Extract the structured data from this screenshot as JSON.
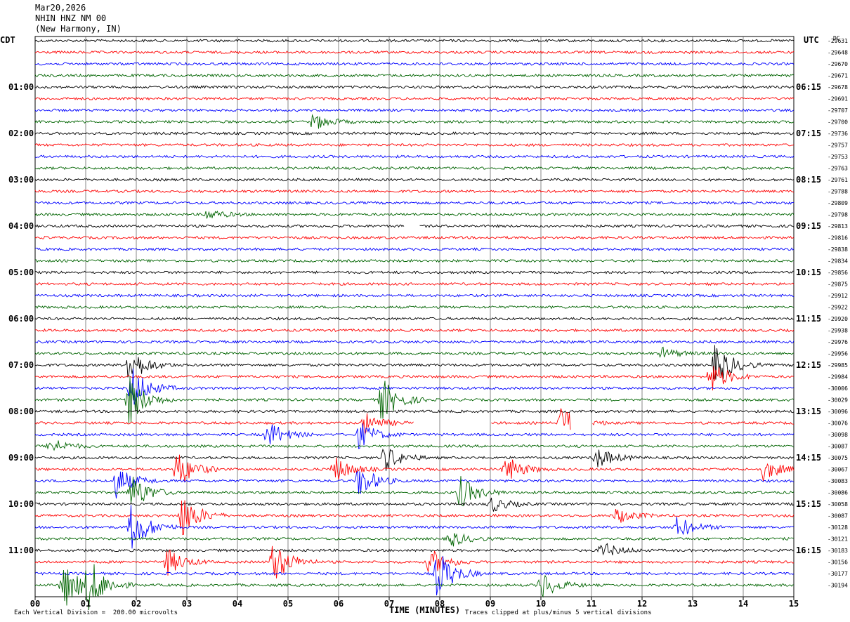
{
  "header": {
    "date": "Mar20,2026",
    "station": "NHIN HNZ NM 00",
    "location": "(New Harmony, IN)"
  },
  "left_tz": "CDT",
  "right_tz": "UTC",
  "dc_label": "DC",
  "footer": {
    "scale_note": "Each Vertical Division =  200.00 microvolts",
    "x_axis_title": "TIME (MINUTES)",
    "clip_note": "Traces clipped at plus/minus 5 vertical divisions"
  },
  "colors": {
    "trace_cycle": [
      "#000000",
      "#ff0000",
      "#0000ff",
      "#006400"
    ],
    "grid": "#000000",
    "background": "#ffffff"
  },
  "chart_data": {
    "type": "line",
    "title": "",
    "xlabel": "TIME (MINUTES)",
    "ylabel": "",
    "xlim": [
      0,
      15
    ],
    "x_ticks": [
      "00",
      "01",
      "02",
      "03",
      "04",
      "05",
      "06",
      "07",
      "08",
      "09",
      "10",
      "11",
      "12",
      "13",
      "14",
      "15"
    ],
    "left_hour_labels": [
      "01:00",
      "02:00",
      "03:00",
      "04:00",
      "05:00",
      "06:00",
      "07:00",
      "08:00",
      "09:00",
      "10:00",
      "11:00"
    ],
    "right_hour_labels": [
      "06:15",
      "07:15",
      "08:15",
      "09:15",
      "10:15",
      "11:15",
      "12:15",
      "13:15",
      "14:15",
      "15:15",
      "16:15"
    ],
    "trace_count": 48,
    "trace_minutes": 15,
    "right_dc_values": [
      "-29631",
      "-29648",
      "-29670",
      "-29671",
      "-29678",
      "-29691",
      "-29707",
      "-29700",
      "-29736",
      "-29757",
      "-29753",
      "-29763",
      "-29761",
      "-29788",
      "-29809",
      "-29798",
      "-29813",
      "-29816",
      "-29838",
      "-29834",
      "-29856",
      "-29875",
      "-29912",
      "-29922",
      "-29920",
      "-29938",
      "-29976",
      "-29956",
      "-29985",
      "-29984",
      "-30006",
      "-30029",
      "-30096",
      "-30076",
      "-30098",
      "-30087",
      "-30075",
      "-30067",
      "-30083",
      "-30086",
      "-30058",
      "-30087",
      "-30128",
      "-30121",
      "-30183",
      "-30156",
      "-30177",
      "-30194"
    ],
    "events": [
      {
        "trace": 7,
        "minute": 5.5,
        "amp": 3
      },
      {
        "trace": 15,
        "minute": 3.4,
        "amp": 2
      },
      {
        "trace": 27,
        "minute": 12.4,
        "amp": 2
      },
      {
        "trace": 28,
        "minute": 1.85,
        "amp": 7
      },
      {
        "trace": 28,
        "minute": 13.45,
        "amp": 8
      },
      {
        "trace": 29,
        "minute": 13.35,
        "amp": 6
      },
      {
        "trace": 30,
        "minute": 1.9,
        "amp": 8
      },
      {
        "trace": 31,
        "minute": 1.85,
        "amp": 9
      },
      {
        "trace": 31,
        "minute": 6.85,
        "amp": 8
      },
      {
        "trace": 33,
        "minute": 10.4,
        "amp": 6
      },
      {
        "trace": 33,
        "minute": 6.5,
        "amp": 4
      },
      {
        "trace": 34,
        "minute": 4.6,
        "amp": 5
      },
      {
        "trace": 34,
        "minute": 6.4,
        "amp": 5
      },
      {
        "trace": 35,
        "minute": 0.3,
        "amp": 3
      },
      {
        "trace": 36,
        "minute": 6.9,
        "amp": 5
      },
      {
        "trace": 36,
        "minute": 11.1,
        "amp": 4
      },
      {
        "trace": 37,
        "minute": 2.8,
        "amp": 7
      },
      {
        "trace": 37,
        "minute": 5.9,
        "amp": 5
      },
      {
        "trace": 37,
        "minute": 9.3,
        "amp": 5
      },
      {
        "trace": 37,
        "minute": 14.4,
        "amp": 4
      },
      {
        "trace": 38,
        "minute": 1.6,
        "amp": 6
      },
      {
        "trace": 38,
        "minute": 6.4,
        "amp": 6
      },
      {
        "trace": 39,
        "minute": 1.9,
        "amp": 7
      },
      {
        "trace": 39,
        "minute": 8.4,
        "amp": 6
      },
      {
        "trace": 40,
        "minute": 9.0,
        "amp": 3
      },
      {
        "trace": 41,
        "minute": 2.9,
        "amp": 8
      },
      {
        "trace": 41,
        "minute": 11.5,
        "amp": 3
      },
      {
        "trace": 42,
        "minute": 1.9,
        "amp": 9
      },
      {
        "trace": 42,
        "minute": 12.7,
        "amp": 4
      },
      {
        "trace": 43,
        "minute": 8.2,
        "amp": 3
      },
      {
        "trace": 44,
        "minute": 11.2,
        "amp": 3
      },
      {
        "trace": 45,
        "minute": 4.7,
        "amp": 8
      },
      {
        "trace": 45,
        "minute": 2.6,
        "amp": 5
      },
      {
        "trace": 45,
        "minute": 7.8,
        "amp": 5
      },
      {
        "trace": 46,
        "minute": 7.95,
        "amp": 9
      },
      {
        "trace": 47,
        "minute": 0.55,
        "amp": 9
      },
      {
        "trace": 47,
        "minute": 1.05,
        "amp": 9
      },
      {
        "trace": 47,
        "minute": 10.0,
        "amp": 5
      }
    ],
    "gaps": [
      {
        "trace": 16,
        "start_minute": 7.3,
        "end_minute": 7.6
      },
      {
        "trace": 33,
        "start_minute": 7.5,
        "end_minute": 9.0
      },
      {
        "trace": 33,
        "start_minute": 10.6,
        "end_minute": 11.0
      }
    ]
  }
}
